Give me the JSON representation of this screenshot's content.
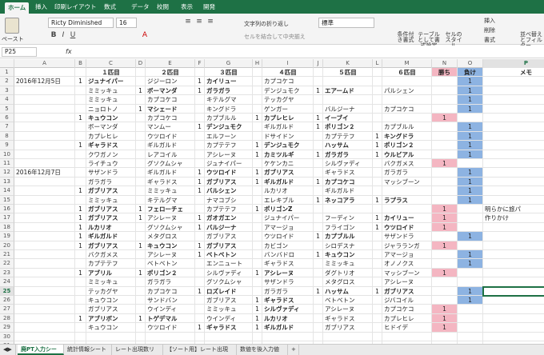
{
  "ribbon": {
    "tabs": [
      "ホーム",
      "挿入",
      "印刷レイアウト",
      "数式",
      "データ",
      "校閲",
      "表示",
      "開発"
    ],
    "active_tab": "ホーム",
    "paste_label": "ペースト",
    "font_name": "Ricty Diminished",
    "font_size": "16",
    "wrap_text": "文字列の折り返し",
    "merge_center": "セルを結合して中央揃え",
    "number_format": "標準",
    "conditional_format": "条件付き書式",
    "format_table": "テーブルとして書式設定",
    "cell_styles": "セルのスタイル",
    "insert": "挿入",
    "delete": "削除",
    "format": "書式",
    "sort_filter": "並べ替えとフィルター"
  },
  "formula_bar": {
    "name_box": "P25",
    "fx": "fx",
    "value": ""
  },
  "columns": [
    "A",
    "B",
    "C",
    "D",
    "E",
    "F",
    "G",
    "H",
    "I",
    "J",
    "K",
    "L",
    "M",
    "N",
    "O",
    "P"
  ],
  "rows": [
    {
      "n": "1",
      "C": "１匹目",
      "E": "２匹目",
      "G": "３匹目",
      "I": "４匹目",
      "K": "５匹目",
      "M": "６匹目",
      "N": "勝ち",
      "O": "負け",
      "P": "メモ",
      "hdr": true
    },
    {
      "n": "2",
      "A": "2016年12月5日",
      "B": "1",
      "C": "ジュナイパー",
      "D": "",
      "E": "ジジーロン",
      "F": "1",
      "G": "カイリュー",
      "I": "カプコケコ",
      "O": "1"
    },
    {
      "n": "3",
      "C": "ミミッキュ",
      "D": "1",
      "E": "ボーマンダ",
      "F": "1",
      "G": "ガラガラ",
      "I": "デンジュモク",
      "J": "1",
      "K": "エアームド",
      "M": "パルシェン",
      "O": "1"
    },
    {
      "n": "4",
      "C": "ミミッキュ",
      "E": "カプコケコ",
      "G": "キテルグマ",
      "I": "テッカグヤ",
      "O": "1"
    },
    {
      "n": "5",
      "C": "ニョロトノ",
      "D": "1",
      "E": "マシェード",
      "G": "キングドラ",
      "I": "ゲンガー",
      "K": "バルジーナ",
      "M": "カプコケコ",
      "O": "1"
    },
    {
      "n": "6",
      "B": "1",
      "C": "キュウコン",
      "E": "カプコケコ",
      "G": "カプブルル",
      "H": "1",
      "I": "カプレヒレ",
      "J": "1",
      "K": "イーブイ",
      "N": "1"
    },
    {
      "n": "7",
      "C": "ボーマンダ",
      "E": "マンムー",
      "F": "1",
      "G": "デンジュモク",
      "I": "ギルガルド",
      "J": "1",
      "K": "ポリゴン２",
      "M": "カプブルル",
      "O": "1"
    },
    {
      "n": "8",
      "C": "カプレヒレ",
      "E": "ウツロイド",
      "G": "エルフーン",
      "I": "ドサイドン",
      "K": "カプテテフ",
      "L": "1",
      "M": "キングドラ",
      "O": "1"
    },
    {
      "n": "9",
      "B": "1",
      "C": "ギャラドス",
      "E": "ギルガルド",
      "G": "カプテテフ",
      "H": "1",
      "I": "デンジュモク",
      "K": "ハッサム",
      "L": "1",
      "M": "ポリゴン２",
      "O": "1"
    },
    {
      "n": "10",
      "C": "クワガノン",
      "E": "レアコイル",
      "G": "アシレーヌ",
      "H": "1",
      "I": "カミツルギ",
      "J": "1",
      "K": "ガラガラ",
      "L": "1",
      "M": "ウルビアル",
      "O": "1"
    },
    {
      "n": "11",
      "C": "ライチュウ",
      "E": "グソクムシャ",
      "G": "ジュナイパー",
      "I": "ケケンカニ",
      "K": "シルヴァディ",
      "M": "バクガメス",
      "N": "1"
    },
    {
      "n": "12",
      "A": "2016年12月7日",
      "C": "サザンドラ",
      "E": "ギルガルド",
      "F": "1",
      "G": "ウツロイド",
      "H": "1",
      "I": "ガブリアス",
      "K": "ギャラドス",
      "M": "ガラガラ",
      "O": "1"
    },
    {
      "n": "13",
      "C": "ガラガラ",
      "E": "ギャラドス",
      "F": "1",
      "G": "ガブリアス",
      "H": "1",
      "I": "ギルガルド",
      "J": "1",
      "K": "カプコケコ",
      "M": "マッシブーン",
      "O": "1"
    },
    {
      "n": "14",
      "B": "1",
      "C": "ガブリアス",
      "E": "ミミッキュ",
      "F": "1",
      "G": "バルシェン",
      "I": "ルカリオ",
      "K": "ギルガルド",
      "O": "1"
    },
    {
      "n": "15",
      "C": "ミミッキュ",
      "E": "キテルグマ",
      "G": "ナマコブシ",
      "I": "エレキブル",
      "J": "1",
      "K": "ネッコアラ",
      "L": "1",
      "M": "ラプラス",
      "O": "1"
    },
    {
      "n": "16",
      "B": "1",
      "C": "ガブリアス",
      "D": "1",
      "E": "フェローチェ",
      "G": "カプテテフ",
      "H": "1",
      "I": "ポリゴンZ",
      "N": "1",
      "P": "明らかに旅パ"
    },
    {
      "n": "17",
      "B": "1",
      "C": "ガブリアス",
      "D": "1",
      "E": "アシレーヌ",
      "F": "1",
      "G": "ガオガエン",
      "I": "ジュナイパー",
      "K": "フーディン",
      "L": "1",
      "M": "カイリュー",
      "N": "1",
      "P": "作りかけ"
    },
    {
      "n": "18",
      "B": "1",
      "C": "ルカリオ",
      "E": "グソクムシャ",
      "F": "1",
      "G": "バルジーナ",
      "I": "アマージョ",
      "K": "フライゴン",
      "L": "1",
      "M": "ウツロイド",
      "N": "1"
    },
    {
      "n": "19",
      "B": "1",
      "C": "ギルガルド",
      "E": "メタグロス",
      "G": "ガブリアス",
      "I": "ウツロイド",
      "J": "1",
      "K": "カプブルル",
      "M": "サザンドラ",
      "O": "1"
    },
    {
      "n": "20",
      "B": "1",
      "C": "ガブリアス",
      "D": "1",
      "E": "キュウコン",
      "F": "1",
      "G": "ガブリアス",
      "I": "カビゴン",
      "K": "シロデスナ",
      "M": "ジャラランガ",
      "N": "1"
    },
    {
      "n": "21",
      "C": "バクガメス",
      "E": "アシレーヌ",
      "F": "1",
      "G": "ベトベトン",
      "I": "バンバドロ",
      "J": "1",
      "K": "キュウコン",
      "M": "アマージョ",
      "O": "1"
    },
    {
      "n": "22",
      "C": "カプテテフ",
      "E": "ベトベトン",
      "G": "エンニュート",
      "I": "ギャラドス",
      "K": "ミミッキュ",
      "M": "オノノクス",
      "O": "1"
    },
    {
      "n": "23",
      "B": "1",
      "C": "アブリル",
      "D": "1",
      "E": "ポリゴン２",
      "G": "シルヴァディ",
      "H": "1",
      "I": "アシレーヌ",
      "K": "ダグトリオ",
      "M": "マッシブーン",
      "N": "1"
    },
    {
      "n": "24",
      "C": "ミミッキュ",
      "E": "ガラガラ",
      "G": "グソクムシャ",
      "I": "サザンドラ",
      "K": "メタグロス",
      "M": "アシレーヌ"
    },
    {
      "n": "25",
      "C": "テッカグヤ",
      "E": "カプコケコ",
      "F": "1",
      "G": "ロズレイド",
      "I": "ガラガラ",
      "J": "1",
      "K": "ハッサム",
      "L": "1",
      "M": "ガブリアス",
      "O": "1"
    },
    {
      "n": "26",
      "C": "キュウコン",
      "E": "サンドバン",
      "G": "ガブリアス",
      "H": "1",
      "I": "ギャラドス",
      "K": "ベトベトン",
      "M": "ジバコイル",
      "O": "1"
    },
    {
      "n": "27",
      "C": "ガブリアス",
      "E": "ウインディ",
      "G": "ミミッキュ",
      "H": "1",
      "I": "シルヴァディ",
      "K": "アシレーヌ",
      "M": "カプコケコ",
      "N": "1"
    },
    {
      "n": "28",
      "B": "1",
      "C": "アブリボン",
      "D": "1",
      "E": "トゲデマル",
      "G": "ウインディ",
      "H": "1",
      "I": "ルカリオ",
      "K": "ギャラドス",
      "M": "カプレヒレ",
      "N": "1"
    },
    {
      "n": "29",
      "C": "キュウコン",
      "E": "ウツロイド",
      "F": "1",
      "G": "ギャラドス",
      "H": "1",
      "I": "ギルガルド",
      "K": "ガブリアス",
      "M": "ヒドイデ",
      "N": "1"
    },
    {
      "n": "30"
    },
    {
      "n": "31"
    },
    {
      "n": "32"
    },
    {
      "n": "33"
    }
  ],
  "bold_pokemon": {
    "2": [
      "C",
      "G"
    ],
    "3": [
      "E",
      "G",
      "K"
    ],
    "5": [
      "E"
    ],
    "6": [
      "C",
      "I",
      "K"
    ],
    "7": [
      "G",
      "K"
    ],
    "8": [
      "M"
    ],
    "9": [
      "C",
      "I",
      "K",
      "M"
    ],
    "10": [
      "I",
      "K",
      "M"
    ],
    "12": [
      "G",
      "I"
    ],
    "13": [
      "G",
      "I",
      "K"
    ],
    "14": [
      "C",
      "G"
    ],
    "15": [
      "K",
      "M"
    ],
    "16": [
      "C",
      "E",
      "I"
    ],
    "17": [
      "C",
      "G",
      "M"
    ],
    "18": [
      "C",
      "G",
      "M"
    ],
    "19": [
      "C",
      "K"
    ],
    "20": [
      "C",
      "E",
      "G"
    ],
    "21": [
      "G",
      "K"
    ],
    "23": [
      "C",
      "E",
      "I"
    ],
    "25": [
      "G",
      "K",
      "M"
    ],
    "26": [
      "I"
    ],
    "27": [
      "I"
    ],
    "28": [
      "C",
      "E",
      "I"
    ],
    "29": [
      "G",
      "I"
    ]
  },
  "selected_cell": {
    "row": "25",
    "col": "P"
  },
  "sheet_tabs": [
    "廃PT入力シート",
    "統計情報シート",
    "レート出現数リスト",
    "【ソート用】レート出現数リスト",
    "数値を後入力値"
  ],
  "active_sheet": "廃PT入力シート",
  "colors": {
    "win": "#f4b6c2",
    "lose": "#8db3e2",
    "brand": "#1e7145"
  }
}
